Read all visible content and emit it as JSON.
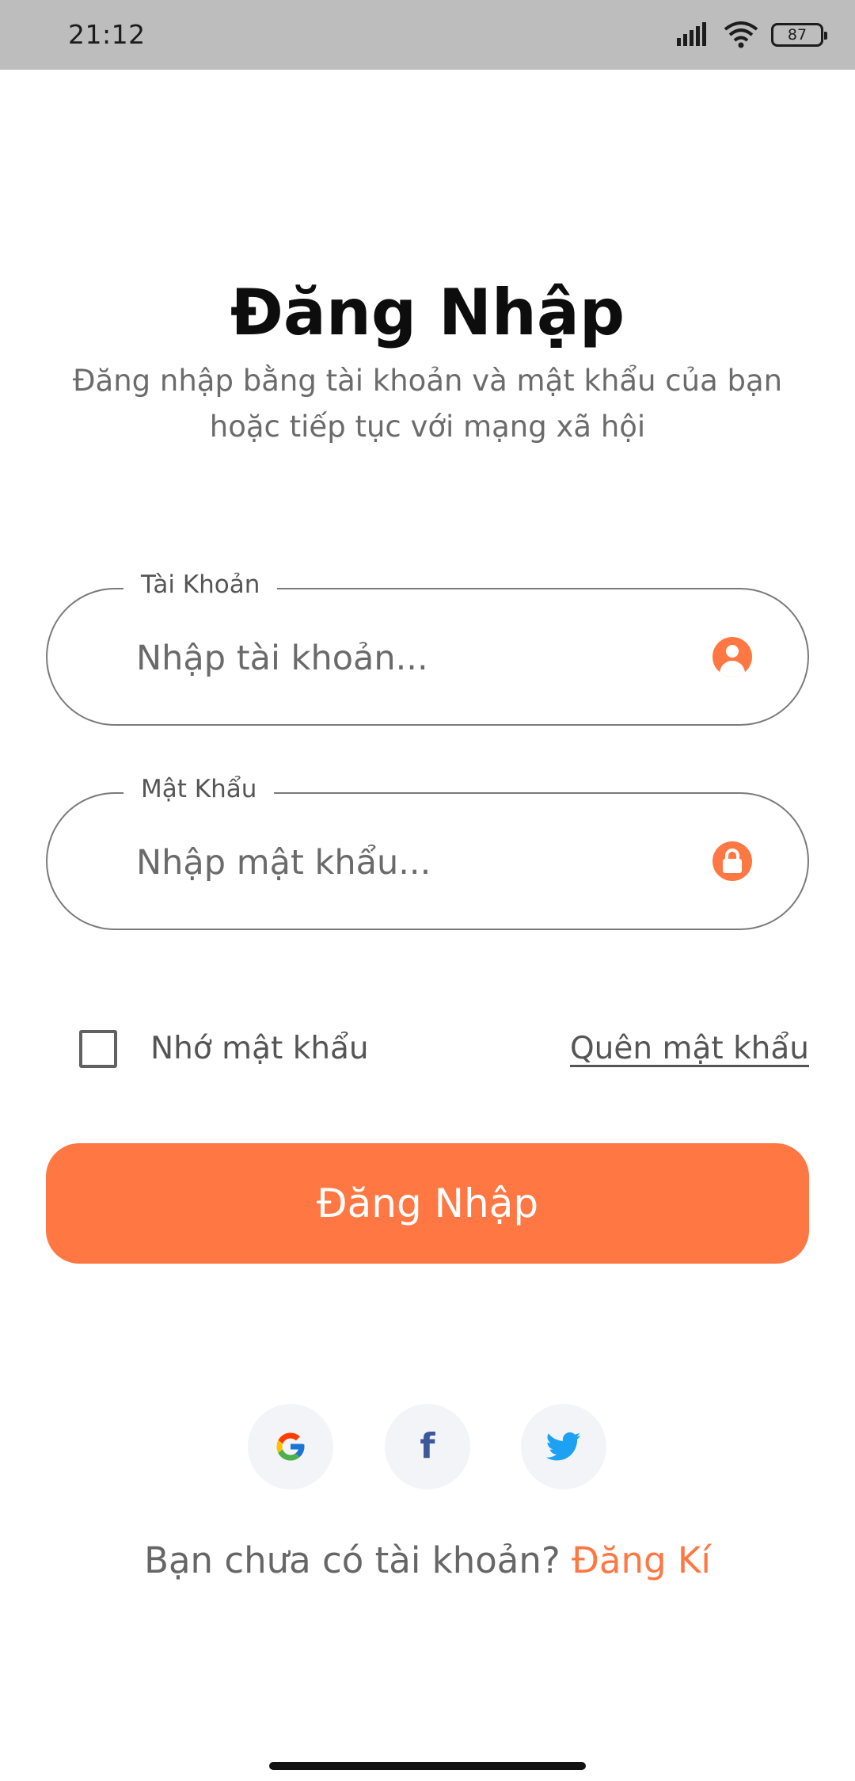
{
  "status_bar": {
    "time": "21:12",
    "battery": "87"
  },
  "header": {
    "title": "Đăng Nhập",
    "subtitle_line1": "Đăng nhập bằng tài khoản và mật khẩu của bạn",
    "subtitle_line2": "hoặc tiếp tục với mạng xã hội"
  },
  "form": {
    "account": {
      "label": "Tài Khoản",
      "placeholder": "Nhập tài khoản..."
    },
    "password": {
      "label": "Mật Khẩu",
      "placeholder": "Nhập mật khẩu..."
    },
    "remember_label": "Nhớ mật khẩu",
    "forgot_label": "Quên mật khẩu",
    "submit_label": "Đăng Nhập"
  },
  "social": {
    "items": [
      {
        "icon": "google-icon"
      },
      {
        "icon": "facebook-icon"
      },
      {
        "icon": "twitter-icon"
      }
    ]
  },
  "signup": {
    "prompt": "Bạn chưa có tài khoản? ",
    "link": "Đăng Kí"
  },
  "colors": {
    "accent": "#ff7742",
    "border": "#7a7a7a",
    "muted_text": "#6b6b6b",
    "social_bg": "#f3f4f8"
  }
}
